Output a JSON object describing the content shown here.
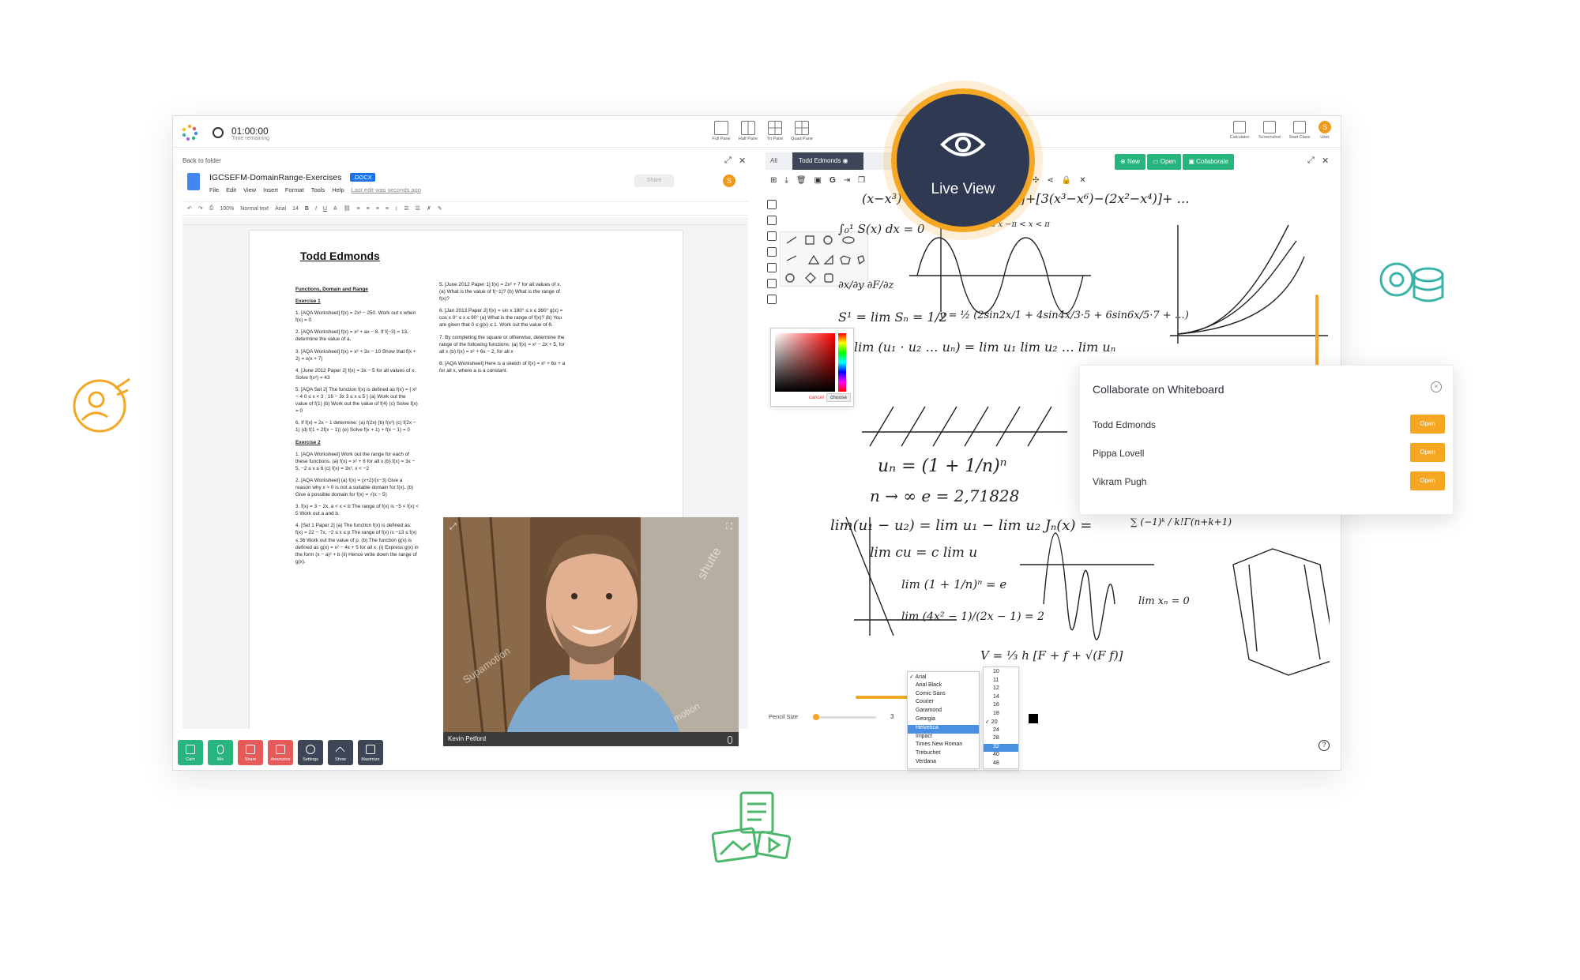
{
  "topbar": {
    "timer_value": "01:00:00",
    "timer_label": "Time remaining",
    "panes": [
      "Full Pane",
      "Half Pane",
      "Tri Pane",
      "Quad Pane"
    ],
    "tools": [
      "Calculator",
      "Screenshot",
      "Start Class",
      "User"
    ],
    "user_initial": "S"
  },
  "doc": {
    "back_label": "Back to folder",
    "file_name": "IGCSEFM-DomainRange-Exercises",
    "file_ext": ".DOCX",
    "menu": [
      "File",
      "Edit",
      "View",
      "Insert",
      "Format",
      "Tools",
      "Help"
    ],
    "last_edit": "Last edit was seconds ago",
    "share_label": "Share",
    "user_initial": "S",
    "toolbar": {
      "zoom": "100%",
      "style": "Normal text",
      "font": "Arial",
      "size": "14"
    },
    "page_title": "Todd Edmonds",
    "section_title": "Functions, Domain and Range",
    "exercise1": "Exercise 1",
    "exercise2": "Exercise 2",
    "col1_ex1": [
      "1.  [AQA Worksheet] f(x) = 2x³ − 250. Work out x when f(x) = 0",
      "2.  [AQA Worksheet] f(x) = x² + ax − 8. If f(−3) = 13, determine the value of a.",
      "3.  [AQA Worksheet] f(x) = x² + 3x − 10 Show that f(x + 2) = x(x + 7)",
      "4.  [June 2012 Paper 2] f(x) = 3x − 5 for all values of x. Solve f(x²) = 43",
      "5.  [AQA Set 2] The function f(x) is defined as f(x) = { x² − 4  0 ≤ x < 3 ; 16 − 3x  3 ≤ x ≤ 5 } (a) Work out the value of f(1) (b) Work out the value of f(4) (c) Solve f(x) = 0",
      "6.  If f(x) = 2x − 1 determine: (a) f(2x) (b) f(x²) (c) f(2x − 1) (d) f(1 + 2f(x − 1)) (e) Solve f(x + 1) + f(x − 1) = 0"
    ],
    "col1_ex2": [
      "1.  [AQA Worksheet] Work out the range for each of these functions. (a) f(x) = x² + 6  for all x (b) f(x) = 3x − 5, −2 ≤ x ≤ 6 (c) f(x) = 3x³, x < −2",
      "2.  [AQA Worksheet] (a) f(x) = (x+2)/(x−3) Give a reason why x > 0 is not a suitable domain for f(x). (b) Give a possible domain for f(x) = √(x − 5)",
      "3.  f(x) = 3 − 2x,  a < x < b The range of f(x) is −5 < f(x) < 5 Work out a and b.",
      "4.  [Set 1 Paper 2] (a) The function f(x) is defined as: f(x) = 22 − 7x,  −2 ≤ x ≤ p The range of f(x) is −13 ≤ f(x) ≤ 36 Work out the value of p. (b) The function g(x) is defined as g(x) = x² − 4x + 5 for all x. (i) Express g(x) in the form (x − a)² + b (ii) Hence write down the range of g(x)."
    ],
    "col2": [
      "5.  [June 2012 Paper 1] f(x) = 2x² + 7 for all values of x. (a) What is the value of f(−1)? (b) What is the range of f(x)?",
      "6.  [Jan 2013 Paper 2] f(x) = sin x   180° ≤ x ≤ 360° g(x) = cos x   0° ≤ x ≤ 90° (a) What is the range of f(x)? (b) You are given that 0 ≤ g(x) ≤ 1. Work out the value of θ.",
      "7.  By completing the square or otherwise, determine the range of the following functions: (a) f(x) = x² − 2x + 5, for all x (b) f(x) = x² + 6x − 2, for all x",
      "8.  [AQA Worksheet] Here is a sketch of f(x) = x² + 6x + a for all x, where a is a constant."
    ]
  },
  "video": {
    "participant": "Kevin Petford",
    "watermark": "Supamotion",
    "watermark2": "shutte",
    "watermark3": "motion"
  },
  "controls": [
    "Cam",
    "Mic",
    "Share",
    "Announce",
    "Settings",
    "Show",
    "Maximize"
  ],
  "whiteboard": {
    "tab_all": "All",
    "tab_active": "Todd Edmonds",
    "actions": [
      "New",
      "Open",
      "Collaborate"
    ],
    "color_cancel": "cancel",
    "color_choose": "choose",
    "pencil_label": "Pencil Size",
    "pencil_value": "3",
    "fonts": [
      "Arial",
      "Arial Black",
      "Comic Sans",
      "Courier",
      "Garamond",
      "Georgia",
      "Helvetica",
      "Impact",
      "Times New Roman",
      "Trebuchet",
      "Verdana"
    ],
    "font_selected": "Helvetica",
    "font_checked": "Arial",
    "sizes": [
      "10",
      "11",
      "12",
      "14",
      "16",
      "18",
      "20",
      "24",
      "28",
      "32",
      "40",
      "48"
    ],
    "size_selected": "32",
    "size_checked": "20",
    "math_lines": [
      "(x−x³)+[2(x²−x⁴)−(x−x³)]+[3(x³−x⁶)−(2x²−x⁴)]+ …",
      "∫₀¹ S(x) dx = 0",
      "y = cos x   −π < x < π",
      "∂x/∂y   ∂F/∂z",
      "S¹ = lim Sₙ = 1/2",
      "y = ½ (2sin2x/1 + 4sin4x/3·5 + 6sin6x/5·7 + …)",
      "lim (u₁ · u₂ … uₙ) = lim u₁ lim u₂ … lim uₙ",
      "uₙ = (1 + 1/n)ⁿ",
      "n → ∞      e = 2,71828",
      "lim(u₁ − u₂) = lim u₁ − lim u₂ Jₙ(x) =",
      "lim cu = c lim u",
      "lim (1 + 1/n)ⁿ = e",
      "lim (4x² − 1)/(2x − 1) = 2",
      "∑ (−1)ᵏ / k!Γ(n+k+1)",
      "lim xₙ = 0",
      "V = ⅓ h [F + f + √(F f)]"
    ]
  },
  "liveview": {
    "label": "Live View"
  },
  "collab": {
    "title": "Collaborate on Whiteboard",
    "users": [
      "Todd Edmonds",
      "Pippa Lovell",
      "Vikram Pugh"
    ],
    "open_label": "Open"
  },
  "colors": {
    "accent": "#f5a623",
    "green": "#27b47d",
    "navy": "#2f3a52",
    "red": "#e65a5a",
    "dark": "#3d4556"
  }
}
